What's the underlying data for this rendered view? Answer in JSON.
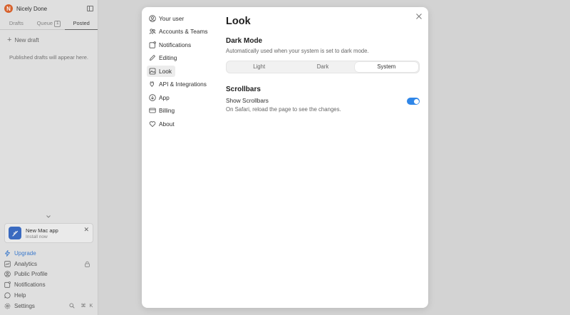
{
  "app": {
    "name": "Nicely Done",
    "logo_letter": "N"
  },
  "sidebar": {
    "tabs": [
      {
        "label": "Drafts"
      },
      {
        "label": "Queue",
        "count": "1"
      },
      {
        "label": "Posted"
      }
    ],
    "new_draft_label": "New draft",
    "empty_message": "Published drafts will appear here.",
    "mac_card": {
      "title": "New Mac app",
      "subtitle": "Install now",
      "close": "✕"
    },
    "bottom_items": [
      {
        "label": "Upgrade",
        "icon": "bolt-icon"
      },
      {
        "label": "Analytics",
        "icon": "chart-icon"
      },
      {
        "label": "Public Profile",
        "icon": "profile-icon"
      },
      {
        "label": "Notifications",
        "icon": "notification-icon"
      },
      {
        "label": "Help",
        "icon": "help-icon"
      },
      {
        "label": "Settings",
        "icon": "gear-icon"
      }
    ],
    "shortcut": {
      "cmd": "⌘",
      "key": "K"
    }
  },
  "settings_nav": [
    {
      "label": "Your user",
      "icon": "user-icon"
    },
    {
      "label": "Accounts & Teams",
      "icon": "team-icon"
    },
    {
      "label": "Notifications",
      "icon": "notification-icon"
    },
    {
      "label": "Editing",
      "icon": "pencil-icon"
    },
    {
      "label": "Look",
      "icon": "image-icon",
      "active": true
    },
    {
      "label": "API & Integrations",
      "icon": "plug-icon"
    },
    {
      "label": "App",
      "icon": "download-icon"
    },
    {
      "label": "Billing",
      "icon": "card-icon"
    },
    {
      "label": "About",
      "icon": "heart-icon"
    }
  ],
  "content": {
    "title": "Look",
    "dark_mode": {
      "title": "Dark Mode",
      "description": "Automatically used when your system is set to dark mode.",
      "options": [
        "Light",
        "Dark",
        "System"
      ],
      "selected": "System"
    },
    "scrollbars": {
      "title": "Scrollbars",
      "label": "Show Scrollbars",
      "help": "On Safari, reload the page to see the changes.",
      "enabled": true
    }
  },
  "colors": {
    "accent": "#2f86e8",
    "upgrade": "#3f7fd4",
    "logo": "#e0662f"
  }
}
